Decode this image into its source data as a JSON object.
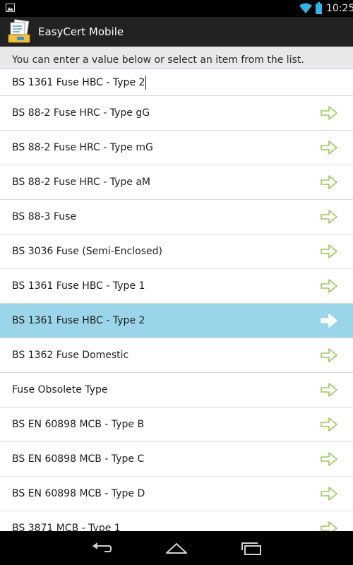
{
  "status_bar": {
    "time": "10:25",
    "icons": [
      "image-notification-icon",
      "wifi-icon",
      "battery-icon"
    ]
  },
  "action_bar": {
    "title": "EasyCert Mobile",
    "icon": "easycert-app-icon"
  },
  "prompt": {
    "text": "You can enter a value below or select an item from the list."
  },
  "entry": {
    "value": "BS 1361 Fuse HBC - Type 2"
  },
  "list": {
    "selected_index": 6,
    "arrow_icon": "arrow-right-icon",
    "arrow_color": "#9cc95a",
    "selected_color": "#9ad5e9",
    "items": [
      {
        "label": "BS 88-2 Fuse HRC - Type gG"
      },
      {
        "label": "BS 88-2 Fuse HRC - Type mG"
      },
      {
        "label": "BS 88-2 Fuse HRC - Type aM"
      },
      {
        "label": "BS 88-3 Fuse"
      },
      {
        "label": "BS 3036 Fuse (Semi-Enclosed)"
      },
      {
        "label": "BS 1361 Fuse HBC - Type 1"
      },
      {
        "label": "BS 1361 Fuse HBC - Type 2"
      },
      {
        "label": "BS 1362 Fuse Domestic"
      },
      {
        "label": "Fuse Obsolete Type"
      },
      {
        "label": "BS EN 60898 MCB - Type B"
      },
      {
        "label": "BS EN 60898 MCB - Type C"
      },
      {
        "label": "BS EN 60898 MCB - Type D"
      },
      {
        "label": "BS 3871 MCB - Type 1"
      }
    ]
  },
  "nav_bar": {
    "buttons": [
      "back-icon",
      "home-icon",
      "recent-apps-icon"
    ]
  }
}
